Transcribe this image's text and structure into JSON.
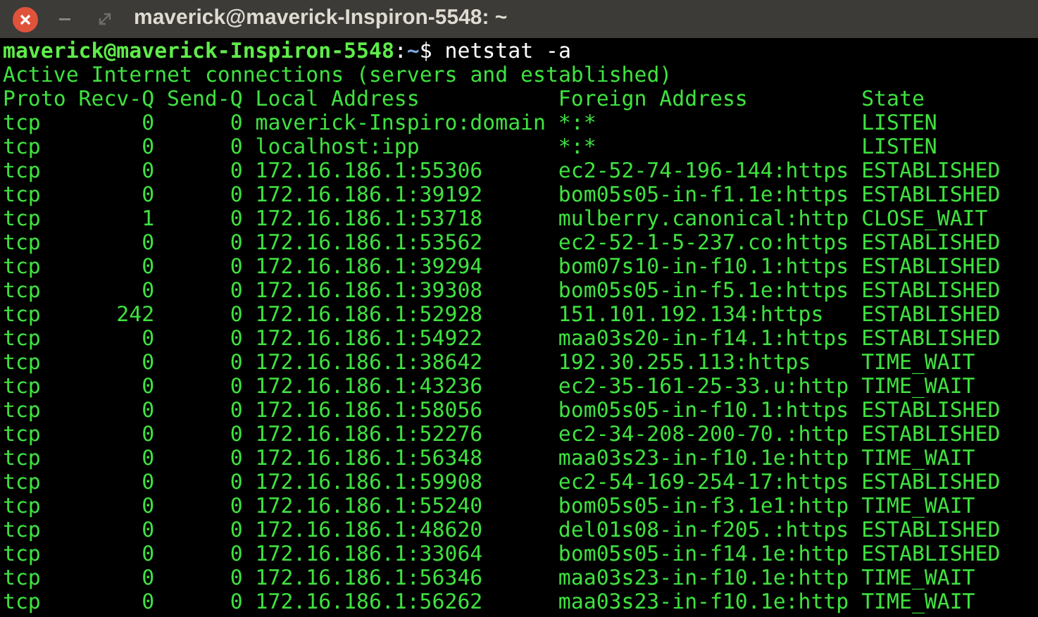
{
  "window": {
    "title": "maverick@maverick-Inspiron-5548: ~"
  },
  "prompt": {
    "user_host": "maverick@maverick-Inspiron-5548",
    "separator": ":",
    "path": "~",
    "symbol": "$",
    "command": "netstat -a"
  },
  "output_title": "Active Internet connections (servers and established)",
  "table": {
    "columns": [
      "Proto",
      "Recv-Q",
      "Send-Q",
      "Local Address",
      "Foreign Address",
      "State"
    ],
    "rows": [
      [
        "tcp",
        "0",
        "0",
        "maverick-Inspiro:domain",
        "*:*",
        "LISTEN"
      ],
      [
        "tcp",
        "0",
        "0",
        "localhost:ipp",
        "*:*",
        "LISTEN"
      ],
      [
        "tcp",
        "0",
        "0",
        "172.16.186.1:55306",
        "ec2-52-74-196-144:https",
        "ESTABLISHED"
      ],
      [
        "tcp",
        "0",
        "0",
        "172.16.186.1:39192",
        "bom05s05-in-f1.1e:https",
        "ESTABLISHED"
      ],
      [
        "tcp",
        "1",
        "0",
        "172.16.186.1:53718",
        "mulberry.canonical:http",
        "CLOSE_WAIT"
      ],
      [
        "tcp",
        "0",
        "0",
        "172.16.186.1:53562",
        "ec2-52-1-5-237.co:https",
        "ESTABLISHED"
      ],
      [
        "tcp",
        "0",
        "0",
        "172.16.186.1:39294",
        "bom07s10-in-f10.1:https",
        "ESTABLISHED"
      ],
      [
        "tcp",
        "0",
        "0",
        "172.16.186.1:39308",
        "bom05s05-in-f5.1e:https",
        "ESTABLISHED"
      ],
      [
        "tcp",
        "242",
        "0",
        "172.16.186.1:52928",
        "151.101.192.134:https",
        "ESTABLISHED"
      ],
      [
        "tcp",
        "0",
        "0",
        "172.16.186.1:54922",
        "maa03s20-in-f14.1:https",
        "ESTABLISHED"
      ],
      [
        "tcp",
        "0",
        "0",
        "172.16.186.1:38642",
        "192.30.255.113:https",
        "TIME_WAIT"
      ],
      [
        "tcp",
        "0",
        "0",
        "172.16.186.1:43236",
        "ec2-35-161-25-33.u:http",
        "TIME_WAIT"
      ],
      [
        "tcp",
        "0",
        "0",
        "172.16.186.1:58056",
        "bom05s05-in-f10.1:https",
        "ESTABLISHED"
      ],
      [
        "tcp",
        "0",
        "0",
        "172.16.186.1:52276",
        "ec2-34-208-200-70.:http",
        "ESTABLISHED"
      ],
      [
        "tcp",
        "0",
        "0",
        "172.16.186.1:56348",
        "maa03s23-in-f10.1e:http",
        "TIME_WAIT"
      ],
      [
        "tcp",
        "0",
        "0",
        "172.16.186.1:59908",
        "ec2-54-169-254-17:https",
        "ESTABLISHED"
      ],
      [
        "tcp",
        "0",
        "0",
        "172.16.186.1:55240",
        "bom05s05-in-f3.1e1:http",
        "TIME_WAIT"
      ],
      [
        "tcp",
        "0",
        "0",
        "172.16.186.1:48620",
        "del01s08-in-f205.:https",
        "ESTABLISHED"
      ],
      [
        "tcp",
        "0",
        "0",
        "172.16.186.1:33064",
        "bom05s05-in-f14.1e:http",
        "ESTABLISHED"
      ],
      [
        "tcp",
        "0",
        "0",
        "172.16.186.1:56346",
        "maa03s23-in-f10.1e:http",
        "TIME_WAIT"
      ],
      [
        "tcp",
        "0",
        "0",
        "172.16.186.1:56262",
        "maa03s23-in-f10.1e:http",
        "TIME_WAIT"
      ]
    ]
  }
}
